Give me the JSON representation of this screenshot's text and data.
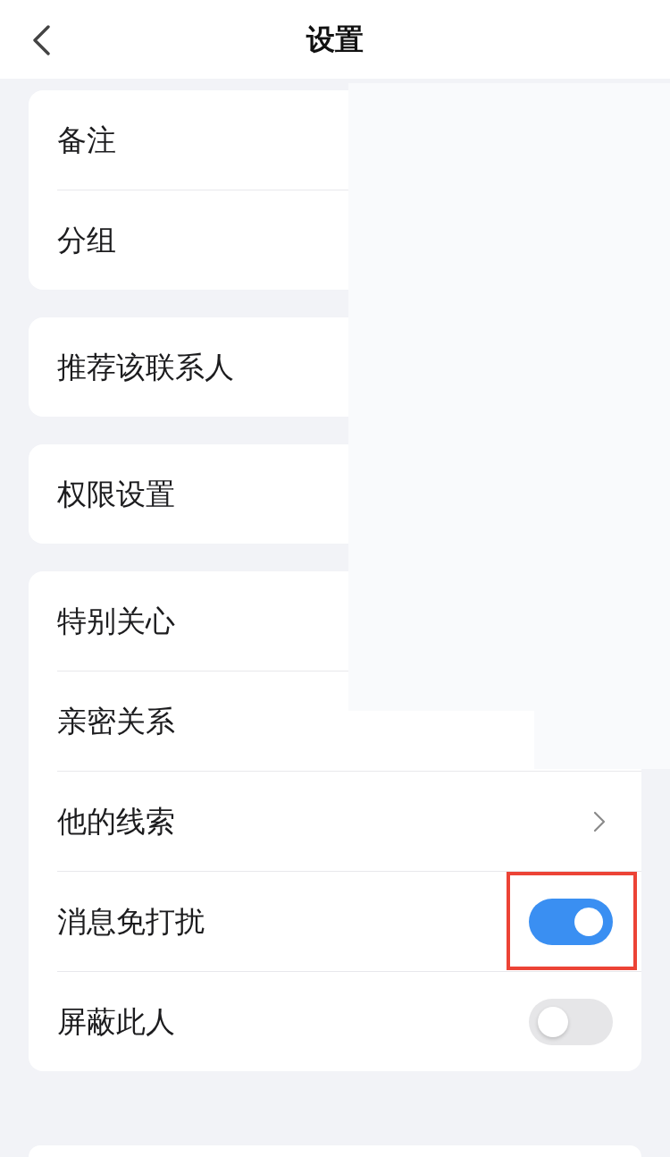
{
  "header": {
    "title": "设置"
  },
  "groups": [
    {
      "items": [
        {
          "kind": "plain",
          "label": "备注",
          "highlighted": false
        },
        {
          "kind": "plain",
          "label": "分组",
          "highlighted": false
        }
      ]
    },
    {
      "items": [
        {
          "kind": "plain",
          "label": "推荐该联系人",
          "highlighted": false
        }
      ]
    },
    {
      "items": [
        {
          "kind": "plain",
          "label": "权限设置",
          "highlighted": false
        }
      ]
    },
    {
      "items": [
        {
          "kind": "plain",
          "label": "特别关心",
          "highlighted": false
        },
        {
          "kind": "plain",
          "label": "亲密关系",
          "highlighted": false
        },
        {
          "kind": "link",
          "label": "他的线索",
          "highlighted": false
        },
        {
          "kind": "toggle",
          "label": "消息免打扰",
          "on": true,
          "highlighted": true
        },
        {
          "kind": "toggle",
          "label": "屏蔽此人",
          "on": false,
          "highlighted": false
        }
      ]
    }
  ]
}
